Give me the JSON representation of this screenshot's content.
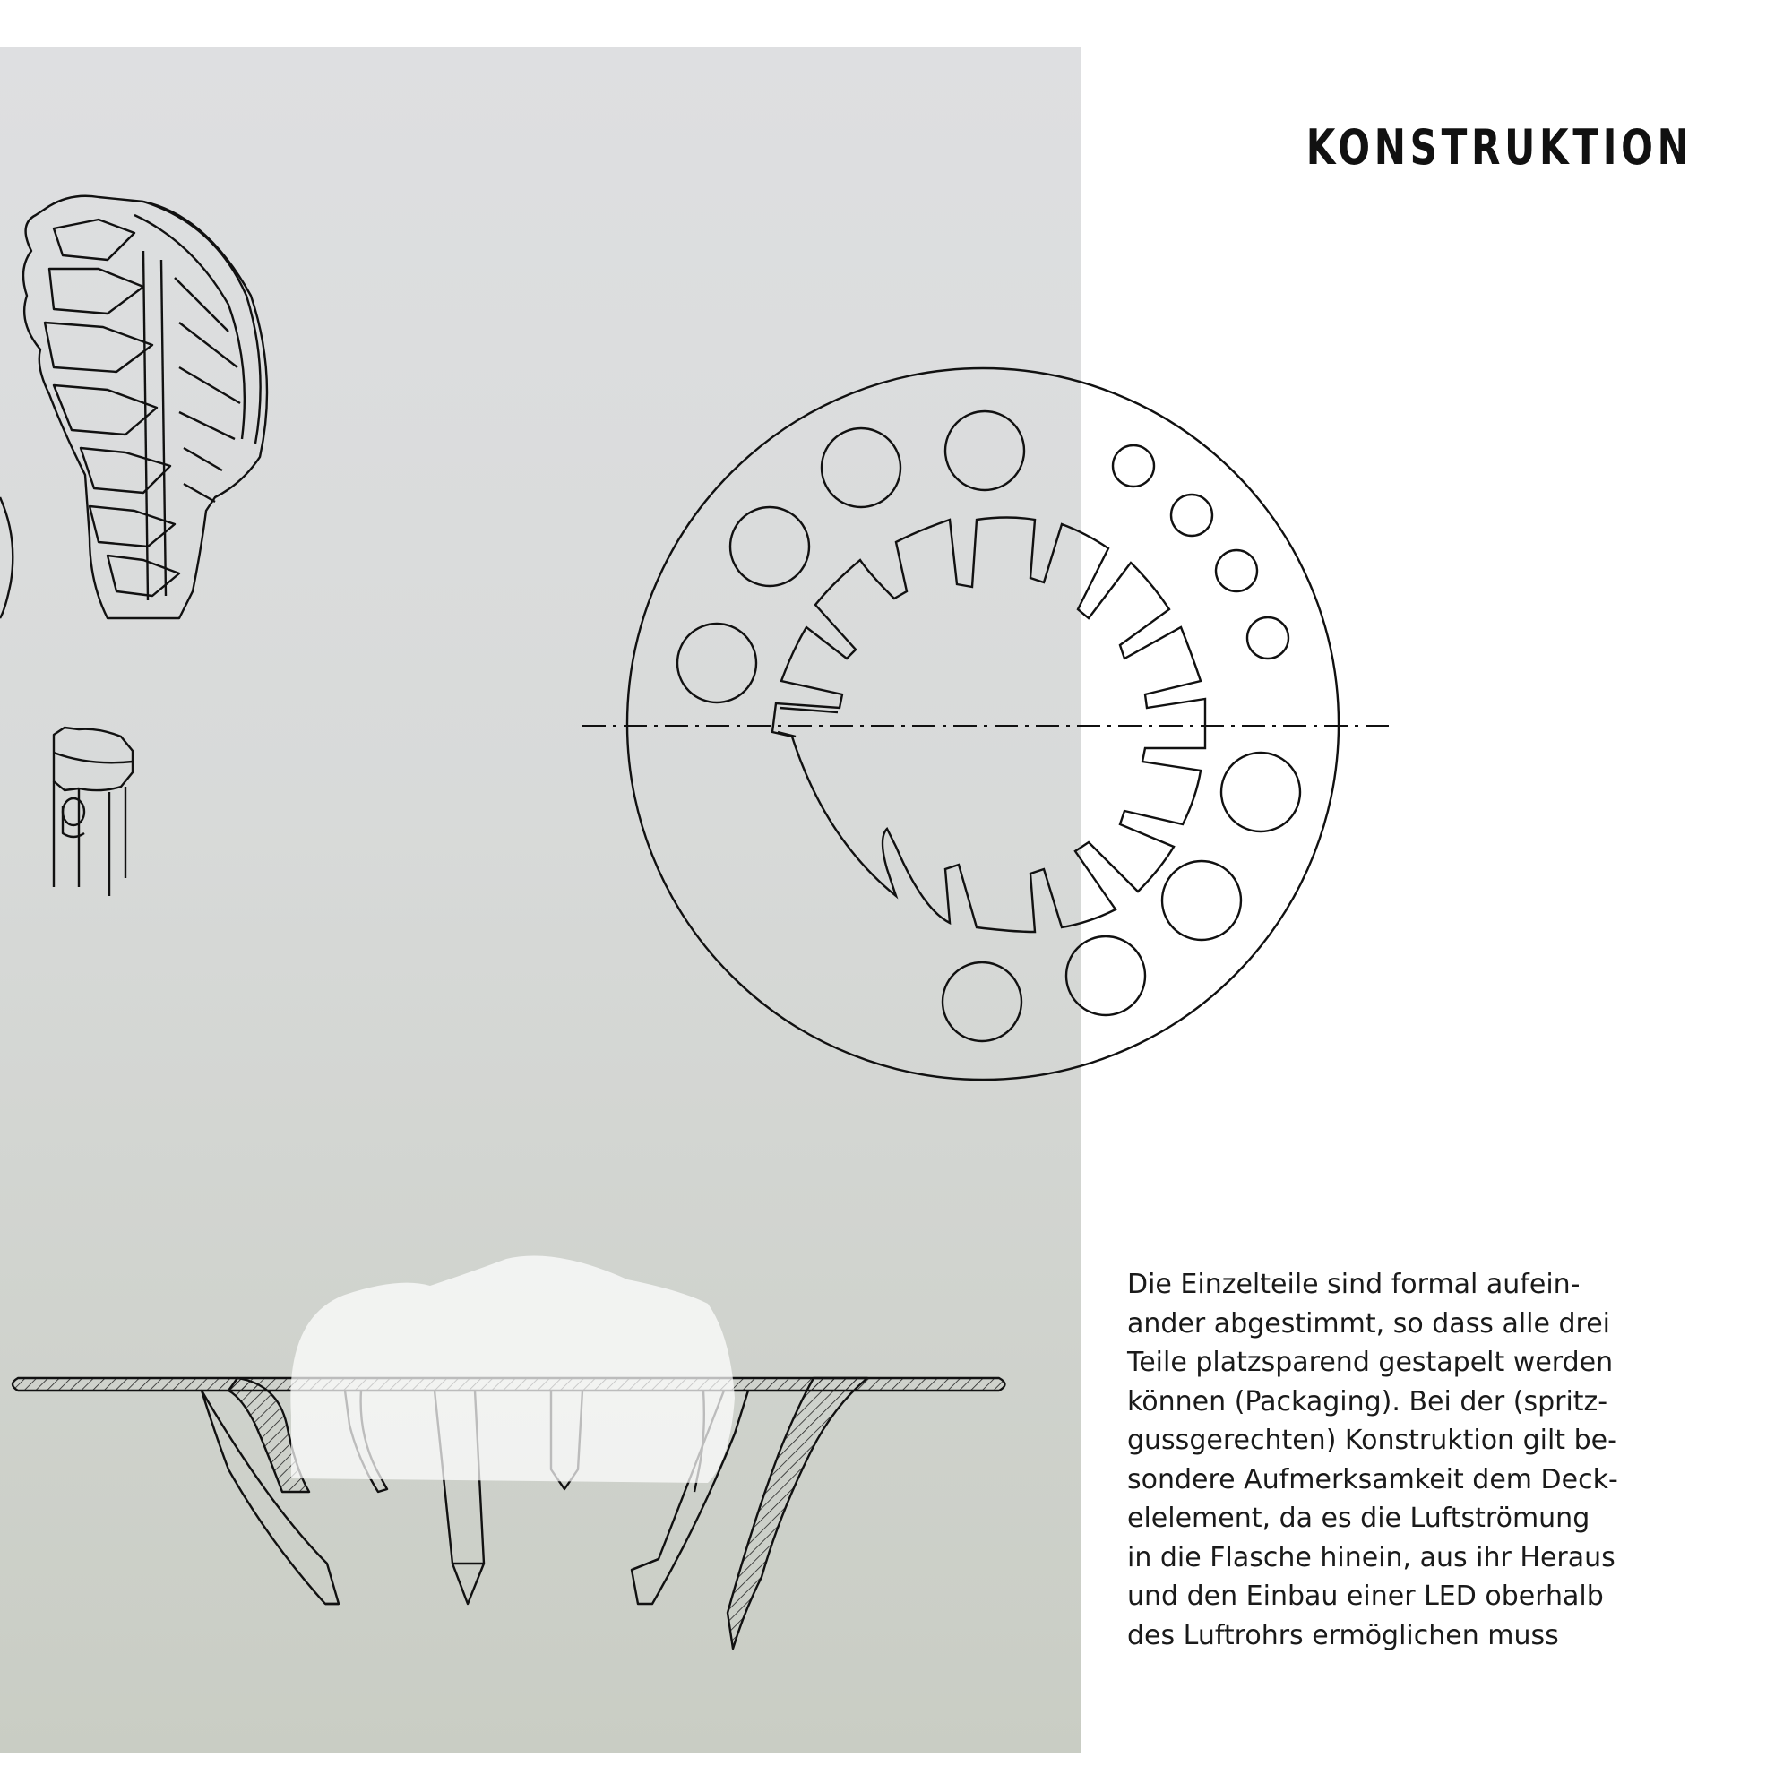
{
  "page": {
    "title": "KONSTRUKTION",
    "body_lines": [
      "Die Einzelteile sind formal aufein-",
      "ander abgestimmt, so dass alle drei",
      "Teile platzsparend gestapelt werden",
      "können (Packaging). Bei der (spritz-",
      "gussgerechten) Konstruktion gilt be-",
      "sondere Aufmerksamkeit dem Deck-",
      "elelement, da es die Luftströmung",
      "in die Flasche hinein, aus ihr Heraus",
      "und den Einbau einer LED oberhalb",
      "des Luftrohrs ermöglichen muss"
    ]
  },
  "colors": {
    "panel_top": "#dedfe1",
    "panel_bottom": "#c9cdc4",
    "line": "#111111",
    "text": "#1a1a1a"
  }
}
